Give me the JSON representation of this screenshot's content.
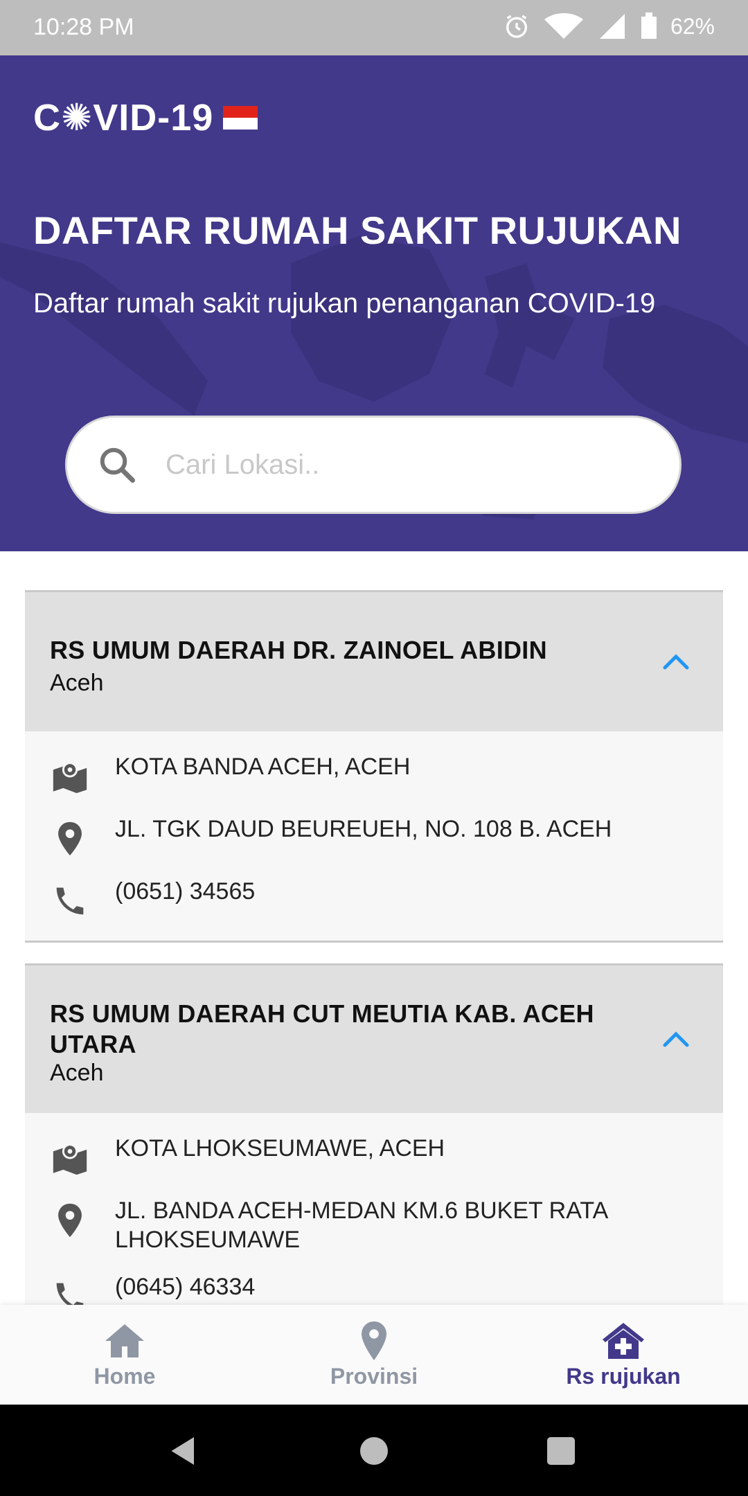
{
  "status_bar": {
    "time": "10:28 PM",
    "battery": "62%"
  },
  "header": {
    "logo_text": "C✺VID-19",
    "title": "DAFTAR RUMAH SAKIT RUJUKAN",
    "subtitle": "Daftar rumah sakit rujukan penanganan COVID-19"
  },
  "search": {
    "placeholder": "Cari Lokasi..",
    "value": ""
  },
  "hospitals": [
    {
      "name": "RS UMUM DAERAH  DR. ZAINOEL ABIDIN",
      "province": "Aceh",
      "region": "KOTA BANDA ACEH, ACEH",
      "address": "JL. TGK DAUD BEUREUEH, NO. 108 B. ACEH",
      "phone": "(0651) 34565"
    },
    {
      "name": "RS UMUM DAERAH CUT MEUTIA KAB. ACEH UTARA",
      "province": "Aceh",
      "region": "KOTA LHOKSEUMAWE, ACEH",
      "address": "JL. BANDA ACEH-MEDAN KM.6 BUKET RATA LHOKSEUMAWE",
      "phone": "(0645) 46334"
    }
  ],
  "bottom_nav": {
    "items": [
      {
        "label": "Home",
        "icon": "home-icon"
      },
      {
        "label": "Provinsi",
        "icon": "location-pin-icon"
      },
      {
        "label": "Rs rujukan",
        "icon": "hospital-icon",
        "active": true
      }
    ]
  },
  "colors": {
    "primary": "#42398b",
    "accent": "#2196f3",
    "card_header": "#e0e0e0",
    "flag_red": "#e2231a"
  }
}
